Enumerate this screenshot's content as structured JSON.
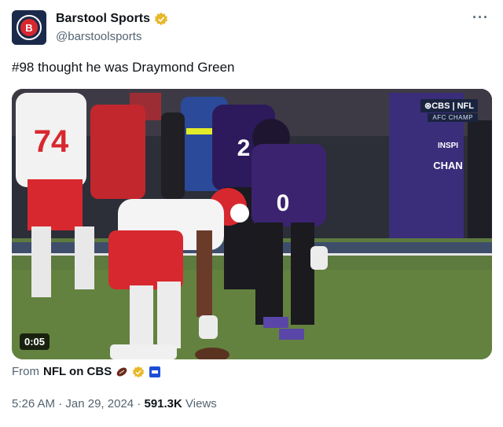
{
  "author": {
    "display_name": "Barstool Sports",
    "handle": "@barstoolsports",
    "verified": true,
    "avatar_icon": "barstool-logo-icon"
  },
  "more_label": "···",
  "tweet": {
    "text": "#98 thought he was Draymond Green"
  },
  "media": {
    "duration": "0:05",
    "broadcast_bug": "⊛CBS | NFL",
    "broadcast_sub": "AFC CHAMP"
  },
  "source": {
    "prefix": "From",
    "account": "NFL on CBS"
  },
  "meta": {
    "time": "5:26 AM",
    "separator": "·",
    "date": "Jan 29, 2024",
    "views_count": "591.3K",
    "views_label": "Views"
  },
  "colors": {
    "verified_gold": "#e8b829",
    "chiefs_red": "#d8282f",
    "ravens_purple": "#3b2370",
    "text_primary": "#0f1419",
    "text_secondary": "#536471"
  }
}
